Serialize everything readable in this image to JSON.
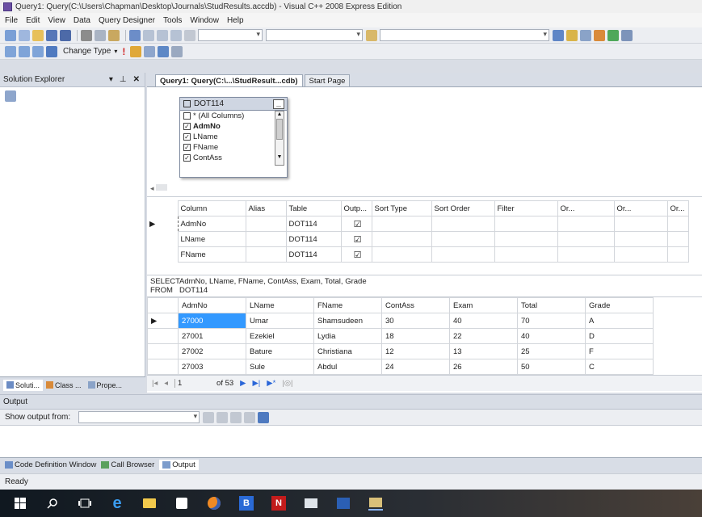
{
  "window": {
    "title": "Query1: Query(C:\\Users\\Chapman\\Desktop\\Journals\\StudResults.accdb) - Visual C++ 2008 Express Edition"
  },
  "menu": [
    "File",
    "Edit",
    "View",
    "Data",
    "Query Designer",
    "Tools",
    "Window",
    "Help"
  ],
  "toolbar2": {
    "change_type": "Change Type"
  },
  "solution_explorer": {
    "title": "Solution Explorer"
  },
  "doc_tabs": {
    "active": "Query1: Query(C:\\...\\StudResult...cdb)",
    "inactive": "Start Page"
  },
  "diagram": {
    "table_name": "DOT114",
    "columns": [
      {
        "label": "* (All Columns)",
        "checked": false
      },
      {
        "label": "AdmNo",
        "checked": true,
        "bold": true
      },
      {
        "label": "LName",
        "checked": true
      },
      {
        "label": "FName",
        "checked": true
      },
      {
        "label": "ContAss",
        "checked": true
      }
    ]
  },
  "criteria": {
    "headers": [
      "Column",
      "Alias",
      "Table",
      "Outp...",
      "Sort Type",
      "Sort Order",
      "Filter",
      "Or...",
      "Or...",
      "Or..."
    ],
    "rows": [
      {
        "column": "AdmNo",
        "alias": "",
        "table": "DOT114",
        "output": "☑"
      },
      {
        "column": "LName",
        "alias": "",
        "table": "DOT114",
        "output": "☑"
      },
      {
        "column": "FName",
        "alias": "",
        "table": "DOT114",
        "output": "☑"
      }
    ]
  },
  "sql": {
    "select_kw": "SELECT",
    "select_cols": "AdmNo, LName, FName, ContAss, Exam, Total, Grade",
    "from_kw": "FROM",
    "from_table": "DOT114"
  },
  "results": {
    "headers": [
      "AdmNo",
      "LName",
      "FName",
      "ContAss",
      "Exam",
      "Total",
      "Grade"
    ],
    "rows": [
      [
        "27000",
        "Umar",
        "Shamsudeen",
        "30",
        "40",
        "70",
        "A"
      ],
      [
        "27001",
        "Ezekiel",
        "Lydia",
        "18",
        "22",
        "40",
        "D"
      ],
      [
        "27002",
        "Bature",
        "Christiana",
        "12",
        "13",
        "25",
        "F"
      ],
      [
        "27003",
        "Sule",
        "Abdul",
        "24",
        "26",
        "50",
        "C"
      ]
    ]
  },
  "navigator": {
    "current": "1",
    "of_total": "of 53"
  },
  "bottom_tabs": [
    "Soluti...",
    "Class ...",
    "Prope..."
  ],
  "output": {
    "title": "Output",
    "show_from_label": "Show output from:"
  },
  "output_tabs": [
    "Code Definition Window",
    "Call Browser",
    "Output"
  ],
  "status": {
    "text": "Ready"
  },
  "colors": {
    "accent": "#3b6fd6",
    "selection": "#3399ff"
  }
}
